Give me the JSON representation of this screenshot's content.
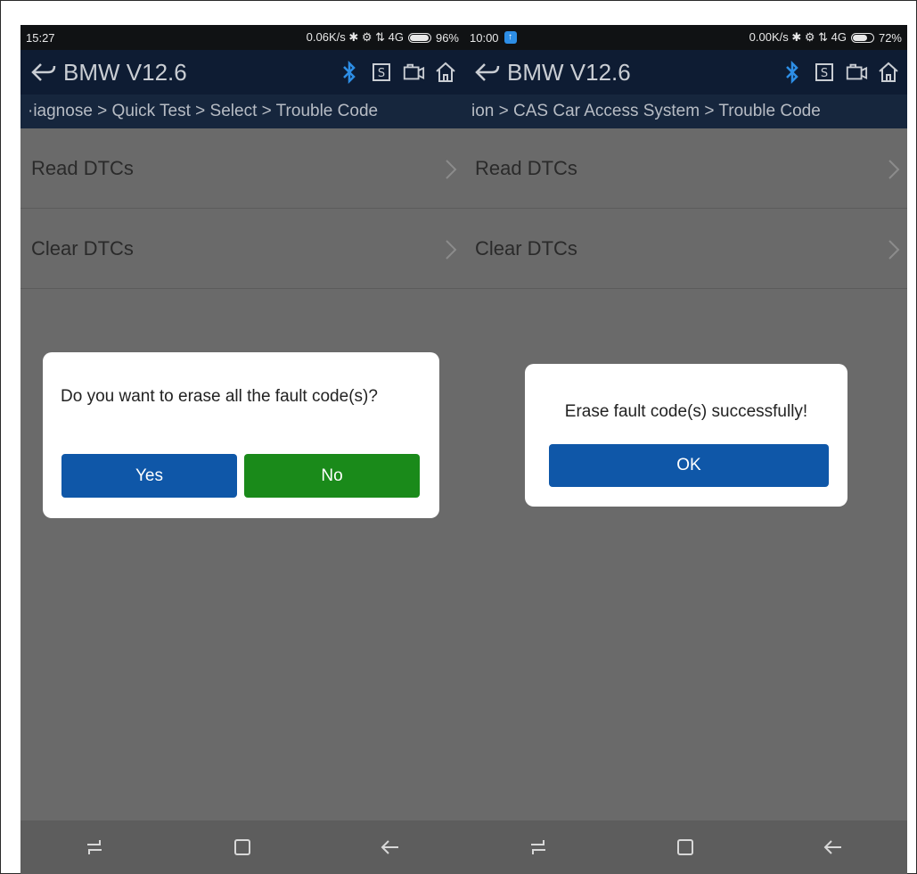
{
  "left": {
    "status": {
      "time": "15:27",
      "right_text": "0.06K/s ✱ ⚙ ⇅ 4G",
      "battery": "96%",
      "battery_level": 0.96
    },
    "app_title": "BMW V12.6",
    "breadcrumb": "·iagnose > Quick Test > Select > Trouble Code",
    "menu": [
      {
        "label": "Read DTCs"
      },
      {
        "label": "Clear DTCs"
      }
    ],
    "dialog": {
      "message": "Do you want to erase all the fault code(s)?",
      "yes": "Yes",
      "no": "No"
    }
  },
  "right": {
    "status": {
      "time": "10:00",
      "right_text": "0.00K/s ✱ ⚙ ⇅ 4G",
      "battery": "72%",
      "battery_level": 0.72
    },
    "app_title": "BMW V12.6",
    "breadcrumb": "ion > CAS Car Access System > Trouble Code",
    "menu": [
      {
        "label": "Read DTCs"
      },
      {
        "label": "Clear DTCs"
      }
    ],
    "dialog": {
      "message": "Erase fault code(s) successfully!",
      "ok": "OK"
    }
  },
  "colors": {
    "header": "#0e1c33",
    "breadcrumb_bg": "#16263d",
    "overlay": "#6a6a6a",
    "blue_button": "#0f57a8",
    "green_button": "#1a8a1a",
    "bluetooth": "#2d8ee6"
  },
  "icons": [
    "back-icon",
    "bluetooth-icon",
    "s-icon",
    "camera-icon",
    "home-icon",
    "chevron-right-icon",
    "recent-apps-icon",
    "home-square-icon",
    "back-arrow-icon"
  ]
}
